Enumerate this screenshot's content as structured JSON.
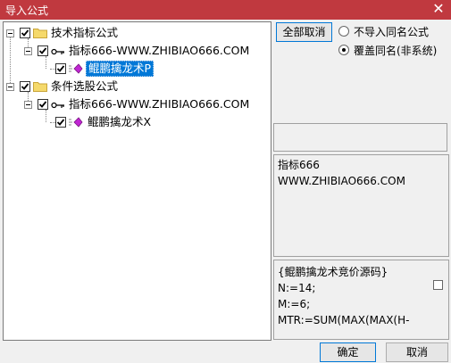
{
  "window": {
    "title": "导入公式",
    "close_glyph": "✕"
  },
  "tree": {
    "groups": [
      {
        "label": "技术指标公式",
        "child": {
          "label": "指标666-WWW.ZHIBIAO666.COM",
          "leaf": "鲲鹏擒龙术P"
        }
      },
      {
        "label": "条件选股公式",
        "child": {
          "label": "指标666-WWW.ZHIBIAO666.COM",
          "leaf": "鲲鹏擒龙术X"
        }
      }
    ]
  },
  "options": {
    "select_all_label": "全部取消",
    "radio_no_import": "不导入同名公式",
    "radio_overwrite": "覆盖同名(非系统)",
    "selected": "overwrite"
  },
  "description": {
    "line1": "指标666",
    "line2": "WWW.ZHIBIAO666.COM"
  },
  "code": {
    "line1": "{鲲鹏擒龙术竞价源码}",
    "line2": "N:=14;",
    "line3": "M:=6;",
    "line4": "MTR:=SUM(MAX(MAX(H-"
  },
  "footer": {
    "ok_label": "确定",
    "cancel_label": "取消"
  }
}
